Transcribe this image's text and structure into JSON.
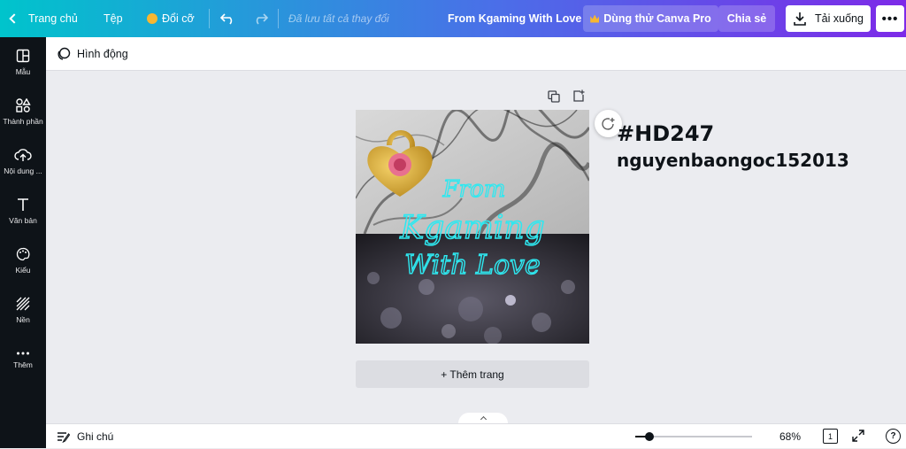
{
  "topbar": {
    "home_label": "Trang chủ",
    "file_label": "Tệp",
    "resize_label": "Đổi cỡ",
    "saved_status": "Đã lưu tất cả thay đổi",
    "doc_title": "From Kgaming With Love",
    "try_pro_label": "Dùng thử Canva Pro",
    "share_label": "Chia sẻ",
    "download_label": "Tải xuống",
    "more_label": "•••"
  },
  "sidebar": {
    "items": [
      {
        "label": "Mẫu",
        "icon": "template-icon"
      },
      {
        "label": "Thành phần",
        "icon": "elements-icon"
      },
      {
        "label": "Nội dung ...",
        "icon": "upload-icon"
      },
      {
        "label": "Văn bản",
        "icon": "text-icon"
      },
      {
        "label": "Kiểu",
        "icon": "style-icon"
      },
      {
        "label": "Nền",
        "icon": "background-icon"
      },
      {
        "label": "Thêm",
        "icon": "more-icon"
      }
    ]
  },
  "toolbar": {
    "animate_label": "Hình động"
  },
  "canvas": {
    "line1": "From",
    "line2": "Kgaming",
    "line3": "With Love"
  },
  "add_page_label": "+ Thêm trang",
  "annotation": {
    "hashtag": "#HD247",
    "username": "nguyenbaongoc152013"
  },
  "bottombar": {
    "notes_label": "Ghi chú",
    "zoom_value": 68,
    "zoom_label": "68%",
    "page_count": "1",
    "help_label": "?"
  },
  "colors": {
    "accent_cyan": "#00c4cc",
    "accent_purple": "#7d2ae8",
    "sidebar_bg": "#0e1318",
    "neon_text": "#2ee8f0"
  }
}
